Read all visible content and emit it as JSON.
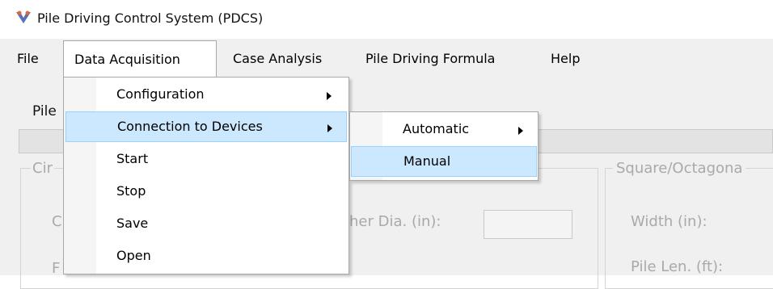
{
  "window": {
    "title": "Pile Driving Control System (PDCS)",
    "icon": "app-icon"
  },
  "menubar": {
    "items": [
      {
        "label": "File"
      },
      {
        "label": "Data Acquisition"
      },
      {
        "label": "Case Analysis"
      },
      {
        "label": "Pile Driving Formula"
      },
      {
        "label": "Help"
      }
    ]
  },
  "data_acquisition_menu": {
    "items": [
      {
        "label": "Configuration",
        "has_submenu": true
      },
      {
        "label": "Connection to Devices",
        "has_submenu": true,
        "highlighted": true
      },
      {
        "label": "Start"
      },
      {
        "label": "Stop"
      },
      {
        "label": "Save"
      },
      {
        "label": "Open"
      }
    ]
  },
  "connection_submenu": {
    "items": [
      {
        "label": "Automatic",
        "has_submenu": true
      },
      {
        "label": "Manual",
        "highlighted": true
      }
    ]
  },
  "form": {
    "pile_label": "Pile",
    "circular_group": "Cir",
    "square_group": "Square/Octagona",
    "circ_field_partial": "C",
    "ther_dia_label": "her Dia. (in):",
    "width_label": "Width (in):",
    "pile_len_label": "Pile Len. (ft):",
    "f_partial": "F"
  },
  "colors": {
    "highlight_bg": "#cce8ff",
    "highlight_border": "#99d1ff",
    "menu_border": "#a8a8a8",
    "window_bg": "#f0f0f0",
    "disabled_text": "#a9a9a9"
  }
}
